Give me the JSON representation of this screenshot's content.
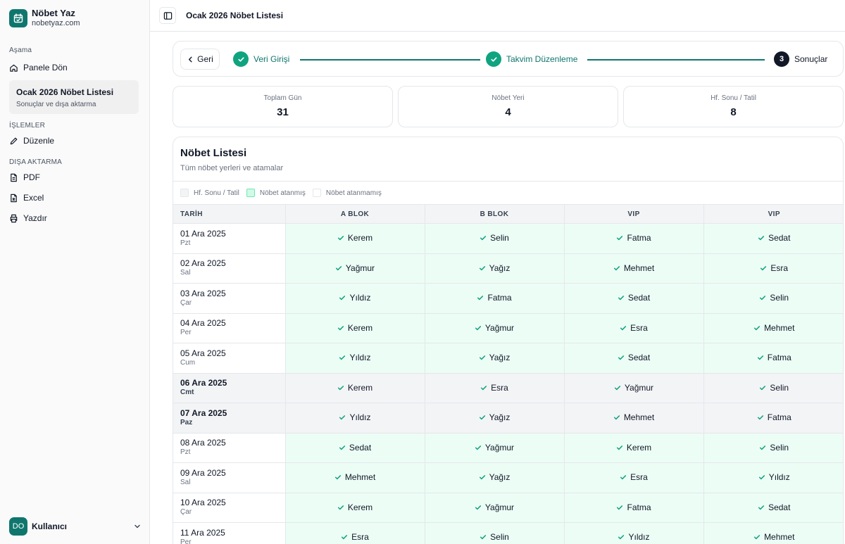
{
  "brand": {
    "name": "Nöbet Yaz",
    "domain": "nobetyaz.com"
  },
  "sidebar": {
    "stage_label": "Aşama",
    "back_to_panel": "Panele Dön",
    "current": {
      "title": "Ocak 2026 Nöbet Listesi",
      "subtitle": "Sonuçlar ve dışa aktarma"
    },
    "operations_label": "İŞLEMLER",
    "edit": "Düzenle",
    "export_label": "DIŞA AKTARMA",
    "pdf": "PDF",
    "excel": "Excel",
    "print": "Yazdır",
    "user": {
      "initials": "DO",
      "name": "Kullanıcı"
    }
  },
  "header": {
    "title": "Ocak 2026 Nöbet Listesi"
  },
  "stepper": {
    "back": "Geri",
    "steps": [
      {
        "label": "Veri Girişi",
        "state": "done"
      },
      {
        "label": "Takvim Düzenleme",
        "state": "done"
      },
      {
        "label": "Sonuçlar",
        "state": "current",
        "number": "3"
      }
    ]
  },
  "stats": [
    {
      "label": "Toplam Gün",
      "value": "31"
    },
    {
      "label": "Nöbet Yeri",
      "value": "4"
    },
    {
      "label": "Hf. Sonu / Tatil",
      "value": "8"
    }
  ],
  "list": {
    "title": "Nöbet Listesi",
    "subtitle": "Tüm nöbet yerleri ve atamalar",
    "legend": {
      "weekend": "Hf. Sonu / Tatil",
      "assigned": "Nöbet atanmış",
      "unassigned": "Nöbet atanmamış"
    },
    "columns": [
      "TARİH",
      "A BLOK",
      "B BLOK",
      "VIP",
      "VIP"
    ],
    "rows": [
      {
        "date": "01 Ara 2025",
        "day": "Pzt",
        "weekend": false,
        "cells": [
          "Kerem",
          "Selin",
          "Fatma",
          "Sedat"
        ]
      },
      {
        "date": "02 Ara 2025",
        "day": "Sal",
        "weekend": false,
        "cells": [
          "Yağmur",
          "Yağız",
          "Mehmet",
          "Esra"
        ]
      },
      {
        "date": "03 Ara 2025",
        "day": "Çar",
        "weekend": false,
        "cells": [
          "Yıldız",
          "Fatma",
          "Sedat",
          "Selin"
        ]
      },
      {
        "date": "04 Ara 2025",
        "day": "Per",
        "weekend": false,
        "cells": [
          "Kerem",
          "Yağmur",
          "Esra",
          "Mehmet"
        ]
      },
      {
        "date": "05 Ara 2025",
        "day": "Cum",
        "weekend": false,
        "cells": [
          "Yıldız",
          "Yağız",
          "Sedat",
          "Fatma"
        ]
      },
      {
        "date": "06 Ara 2025",
        "day": "Cmt",
        "weekend": true,
        "cells": [
          "Kerem",
          "Esra",
          "Yağmur",
          "Selin"
        ]
      },
      {
        "date": "07 Ara 2025",
        "day": "Paz",
        "weekend": true,
        "cells": [
          "Yıldız",
          "Yağız",
          "Mehmet",
          "Fatma"
        ]
      },
      {
        "date": "08 Ara 2025",
        "day": "Pzt",
        "weekend": false,
        "cells": [
          "Sedat",
          "Yağmur",
          "Kerem",
          "Selin"
        ]
      },
      {
        "date": "09 Ara 2025",
        "day": "Sal",
        "weekend": false,
        "cells": [
          "Mehmet",
          "Yağız",
          "Esra",
          "Yıldız"
        ]
      },
      {
        "date": "10 Ara 2025",
        "day": "Çar",
        "weekend": false,
        "cells": [
          "Kerem",
          "Yağmur",
          "Fatma",
          "Sedat"
        ]
      },
      {
        "date": "11 Ara 2025",
        "day": "Per",
        "weekend": false,
        "cells": [
          "Esra",
          "Selin",
          "Yıldız",
          "Mehmet"
        ]
      }
    ]
  },
  "colors": {
    "accent": "#0f766e",
    "check": "#10a37f",
    "assigned_bg": "#ecfdf5",
    "weekend_bg": "#f3f4f6"
  }
}
